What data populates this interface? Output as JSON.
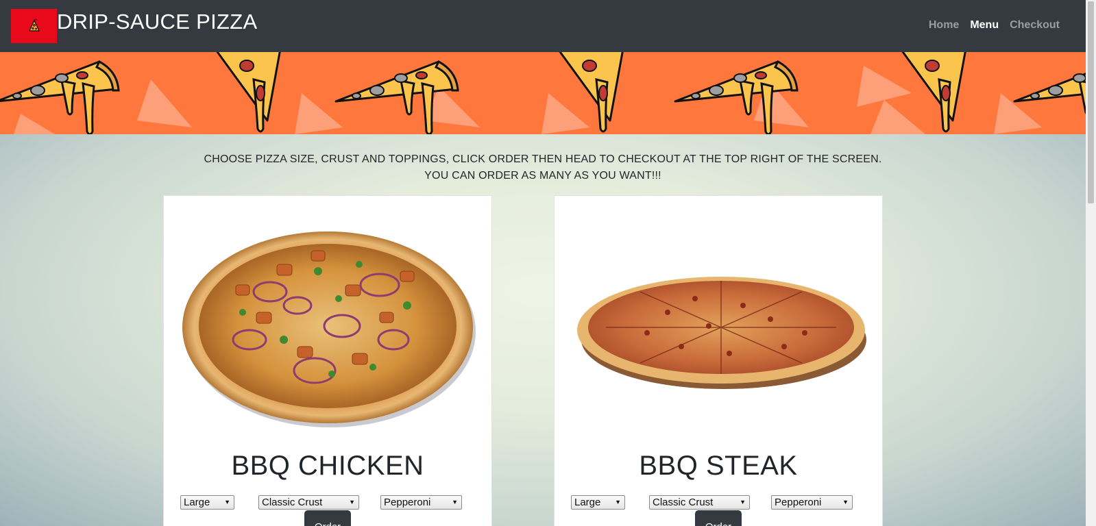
{
  "header": {
    "brand": "DRIP-SAUCE PIZZA",
    "logo_icon": "pizza-slice-icon",
    "nav": [
      {
        "label": "Home",
        "active": false
      },
      {
        "label": "Menu",
        "active": true
      },
      {
        "label": "Checkout",
        "active": false
      }
    ]
  },
  "banner": {
    "image": "pizza-slices-pattern"
  },
  "main": {
    "instructions": [
      "CHOOSE PIZZA SIZE, CRUST AND TOPPINGS, CLICK ORDER THEN HEAD TO CHECKOUT AT THE TOP RIGHT OF THE SCREEN.",
      "YOU CAN ORDER AS MANY AS YOU WANT!!!"
    ],
    "cards": [
      {
        "name": "BBQ CHICKEN",
        "size": "Large",
        "crust": "Classic Crust",
        "topping": "Pepperoni",
        "order_label": "Order"
      },
      {
        "name": "BBQ STEAK",
        "size": "Large",
        "crust": "Classic Crust",
        "topping": "Pepperoni",
        "order_label": "Order"
      }
    ]
  },
  "colors": {
    "navbar": "#343a40",
    "logo_bg": "#e8091b",
    "banner_bg": "#fe773c",
    "button_bg": "#343a40"
  }
}
